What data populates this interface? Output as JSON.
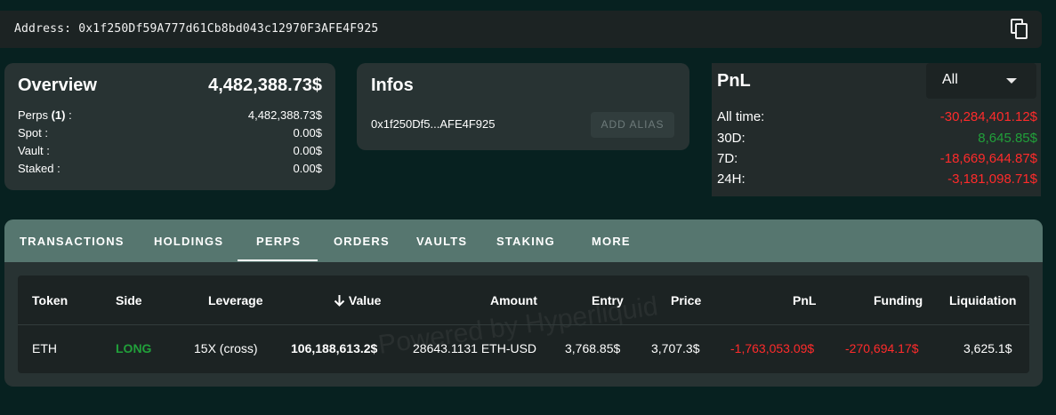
{
  "address_bar": {
    "label": "Address:",
    "value": "0x1f250Df59A777d61Cb8bd043c12970F3AFE4F925"
  },
  "overview": {
    "title": "Overview",
    "total": "4,482,388.73$",
    "rows": [
      {
        "label": "Perps ",
        "count": "(1)",
        "suffix": " :",
        "value": "4,482,388.73$"
      },
      {
        "label": "Spot :",
        "value": "0.00$"
      },
      {
        "label": "Vault :",
        "value": "0.00$"
      },
      {
        "label": "Staked :",
        "value": "0.00$"
      }
    ]
  },
  "infos": {
    "title": "Infos",
    "short_address": "0x1f250Df5...AFE4F925",
    "add_alias_label": "ADD ALIAS"
  },
  "pnl": {
    "title": "PnL",
    "period_select": "All",
    "rows": [
      {
        "label": "All time:",
        "value": "-30,284,401.12$",
        "color": "#ff2b2b"
      },
      {
        "label": "30D:",
        "value": "8,645.85$",
        "color": "#21a03a"
      },
      {
        "label": "7D:",
        "value": "-18,669,644.87$",
        "color": "#ff2b2b"
      },
      {
        "label": "24H:",
        "value": "-3,181,098.71$",
        "color": "#ff2b2b"
      }
    ]
  },
  "tabs": {
    "items": [
      "TRANSACTIONS",
      "HOLDINGS",
      "PERPS",
      "ORDERS",
      "VAULTS",
      "STAKING",
      "MORE"
    ],
    "active": "PERPS"
  },
  "table": {
    "watermark": "Powered by Hyperliquid",
    "columns": [
      "Token",
      "Side",
      "Leverage",
      "Value",
      "Amount",
      "Entry",
      "Price",
      "PnL",
      "Funding",
      "Liquidation"
    ],
    "sort_column": "Value",
    "rows": [
      {
        "token": "ETH",
        "side": "LONG",
        "leverage": "15X (cross)",
        "value": "106,188,613.2$",
        "amount": "28643.1131 ETH-USD",
        "entry": "3,768.85$",
        "price": "3,707.3$",
        "pnl": "-1,763,053.09$",
        "funding": "-270,694.17$",
        "liquidation": "3,625.1$"
      }
    ]
  },
  "colors": {
    "background": "#072120",
    "card": "#283333",
    "tab_bar": "#56766f",
    "negative": "#ff2b2b",
    "positive": "#21a03a"
  }
}
